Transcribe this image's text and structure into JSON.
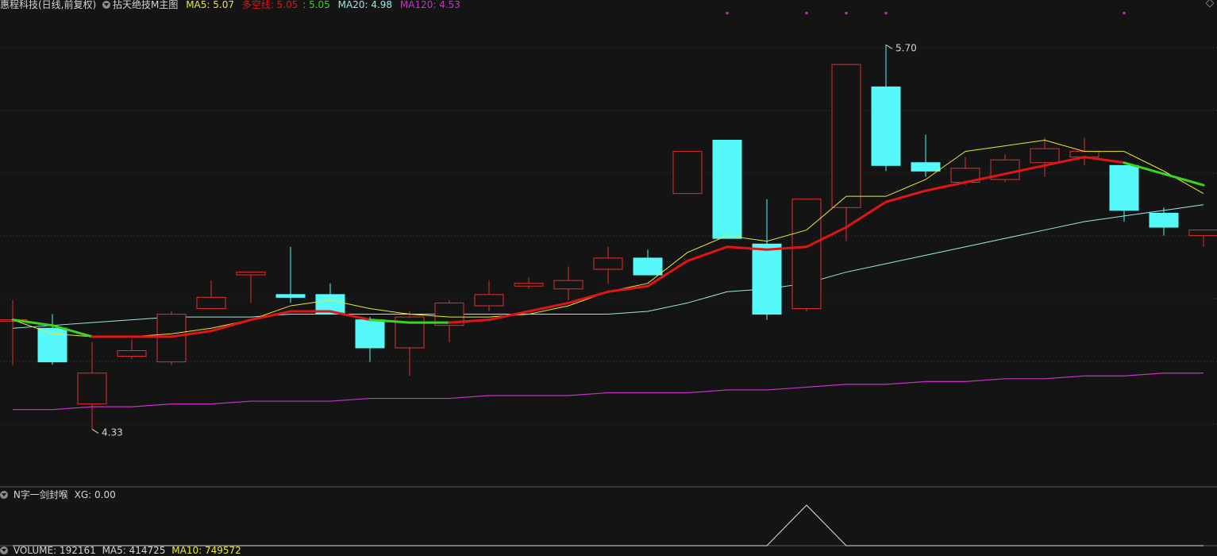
{
  "header": {
    "stock_title": "惠程科技(日线,前复权)",
    "indicator_name": "拈天绝技M主图",
    "ma5": "MA5: 5.07",
    "dkx_label": "多空线: 5.05",
    "dkx_value2": ": 5.05",
    "ma20": "MA20: 4.98",
    "ma120": "MA120: 4.53"
  },
  "sub_indicator": {
    "name": "N字一剑封喉",
    "xg": "XG: 0.00"
  },
  "volume_bar": {
    "volume": "VOLUME: 192161",
    "ma5": "MA5: 414725",
    "ma10": "MA10: 749572"
  },
  "colors": {
    "background": "#141414",
    "up": "#e03131",
    "down": "#55f9f9",
    "ma5": "#e8e83a",
    "dkx_up": "#e01515",
    "dkx_down": "#37d620",
    "ma20": "#9de8ea",
    "ma120": "#c832c8",
    "white_text": "#d4d4d4",
    "grid": "#3a3a3a",
    "marker": "#c030c0"
  },
  "chart_data": {
    "type": "candlestick",
    "price_range": [
      4.15,
      5.82
    ],
    "annotations": [
      {
        "text": "5.70",
        "kind": "max",
        "candle_index": 22
      },
      {
        "text": "4.33",
        "kind": "min",
        "candle_index": 2
      }
    ],
    "candles": [
      {
        "o": 4.72,
        "c": 4.72,
        "h": 4.79,
        "l": 4.56
      },
      {
        "o": 4.69,
        "c": 4.57,
        "h": 4.74,
        "l": 4.56
      },
      {
        "o": 4.42,
        "c": 4.53,
        "h": 4.64,
        "l": 4.33
      },
      {
        "o": 4.59,
        "c": 4.61,
        "h": 4.65,
        "l": 4.58
      },
      {
        "o": 4.57,
        "c": 4.74,
        "h": 4.75,
        "l": 4.56
      },
      {
        "o": 4.76,
        "c": 4.8,
        "h": 4.86,
        "l": 4.76
      },
      {
        "o": 4.88,
        "c": 4.89,
        "h": 4.86,
        "l": 4.78
      },
      {
        "o": 4.81,
        "c": 4.8,
        "h": 4.98,
        "l": 4.78
      },
      {
        "o": 4.81,
        "c": 4.74,
        "h": 4.85,
        "l": 4.74
      },
      {
        "o": 4.72,
        "c": 4.62,
        "h": 4.73,
        "l": 4.57
      },
      {
        "o": 4.62,
        "c": 4.73,
        "h": 4.75,
        "l": 4.52
      },
      {
        "o": 4.7,
        "c": 4.78,
        "h": 4.79,
        "l": 4.64
      },
      {
        "o": 4.77,
        "c": 4.81,
        "h": 4.86,
        "l": 4.75
      },
      {
        "o": 4.84,
        "c": 4.85,
        "h": 4.87,
        "l": 4.83
      },
      {
        "o": 4.83,
        "c": 4.86,
        "h": 4.91,
        "l": 4.79
      },
      {
        "o": 4.9,
        "c": 4.94,
        "h": 4.98,
        "l": 4.85
      },
      {
        "o": 4.94,
        "c": 4.88,
        "h": 4.97,
        "l": 4.89
      },
      {
        "o": 5.17,
        "c": 5.32,
        "h": 5.32,
        "l": 5.17
      },
      {
        "o": 5.36,
        "c": 5.01,
        "h": 5.36,
        "l": 5.01
      },
      {
        "o": 4.99,
        "c": 4.74,
        "h": 5.15,
        "l": 4.72
      },
      {
        "o": 4.76,
        "c": 5.15,
        "h": 5.15,
        "l": 4.75
      },
      {
        "o": 5.12,
        "c": 5.63,
        "h": 5.63,
        "l": 5.0
      },
      {
        "o": 5.55,
        "c": 5.27,
        "h": 5.7,
        "l": 5.25
      },
      {
        "o": 5.28,
        "c": 5.25,
        "h": 5.38,
        "l": 5.23
      },
      {
        "o": 5.21,
        "c": 5.26,
        "h": 5.3,
        "l": 5.2
      },
      {
        "o": 5.22,
        "c": 5.29,
        "h": 5.31,
        "l": 5.21
      },
      {
        "o": 5.28,
        "c": 5.33,
        "h": 5.37,
        "l": 5.23
      },
      {
        "o": 5.3,
        "c": 5.32,
        "h": 5.37,
        "l": 5.27
      },
      {
        "o": 5.27,
        "c": 5.11,
        "h": 5.27,
        "l": 5.07
      },
      {
        "o": 5.1,
        "c": 5.05,
        "h": 5.12,
        "l": 5.02
      },
      {
        "o": 5.02,
        "c": 5.04,
        "h": 5.04,
        "l": 4.98
      }
    ],
    "ma5": [
      4.72,
      4.67,
      4.66,
      4.66,
      4.67,
      4.69,
      4.72,
      4.77,
      4.79,
      4.76,
      4.74,
      4.73,
      4.73,
      4.74,
      4.77,
      4.82,
      4.85,
      4.96,
      5.02,
      5.0,
      5.04,
      5.16,
      5.16,
      5.22,
      5.32,
      5.34,
      5.36,
      5.32,
      5.32,
      5.25,
      5.17
    ],
    "dkx": [
      4.72,
      4.7,
      4.66,
      4.66,
      4.66,
      4.68,
      4.72,
      4.75,
      4.75,
      4.72,
      4.71,
      4.71,
      4.72,
      4.75,
      4.78,
      4.82,
      4.84,
      4.93,
      4.98,
      4.97,
      4.98,
      5.05,
      5.14,
      5.18,
      5.21,
      5.24,
      5.27,
      5.3,
      5.28,
      5.24,
      5.2
    ],
    "ma20": [
      4.69,
      4.7,
      4.71,
      4.72,
      4.73,
      4.73,
      4.73,
      4.74,
      4.74,
      4.74,
      4.74,
      4.74,
      4.74,
      4.74,
      4.74,
      4.74,
      4.75,
      4.78,
      4.82,
      4.83,
      4.85,
      4.89,
      4.92,
      4.95,
      4.98,
      5.01,
      5.04,
      5.07,
      5.09,
      5.11,
      5.13
    ],
    "ma120": [
      4.4,
      4.4,
      4.41,
      4.41,
      4.42,
      4.42,
      4.43,
      4.43,
      4.43,
      4.44,
      4.44,
      4.44,
      4.45,
      4.45,
      4.45,
      4.46,
      4.46,
      4.46,
      4.47,
      4.47,
      4.48,
      4.49,
      4.49,
      4.5,
      4.5,
      4.51,
      4.51,
      4.52,
      4.52,
      4.53,
      4.53
    ],
    "dkx_green_segments": [
      [
        0,
        2
      ],
      [
        9,
        11
      ],
      [
        28,
        30
      ]
    ],
    "top_markers": [
      18,
      20,
      21,
      22,
      28
    ],
    "xg_signal": [
      0,
      0,
      0,
      0,
      0,
      0,
      0,
      0,
      0,
      0,
      0,
      0,
      0,
      0,
      0,
      0,
      0,
      0,
      0,
      0,
      1,
      0,
      0,
      0,
      0,
      0,
      0,
      0,
      0,
      0,
      0
    ]
  }
}
